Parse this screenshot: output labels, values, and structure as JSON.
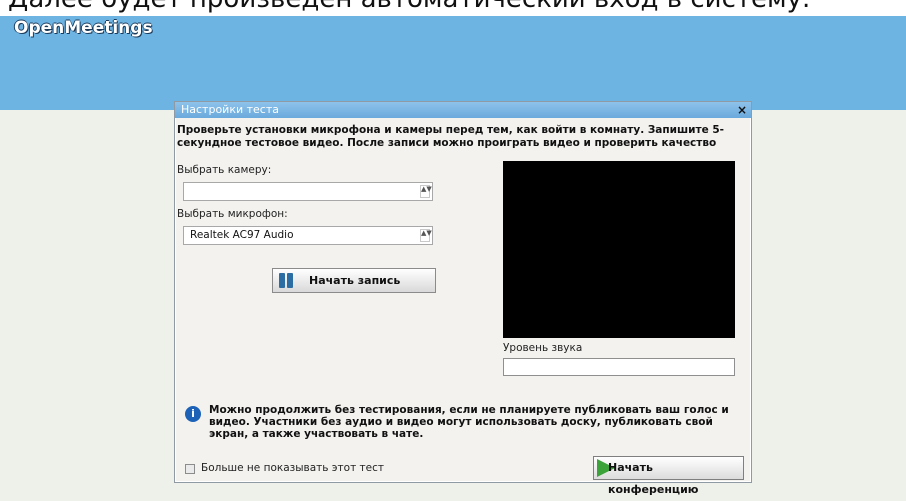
{
  "page": {
    "caption": "Далее будет произведен автоматический вход в систему.",
    "brand": "OpenMeetings"
  },
  "dialog": {
    "title": "Настройки теста",
    "close_glyph": "×",
    "instructions": "Проверьте установки микрофона и камеры перед тем, как войти в комнату. Запишите 5-секундное тестовое видео. После записи можно проиграть видео и проверить качество",
    "camera": {
      "label": "Выбрать камеру:",
      "value": ""
    },
    "microphone": {
      "label": "Выбрать микрофон:",
      "value": "Realtek AC97 Audio"
    },
    "spinner_glyph": "▲▼",
    "record_button": {
      "label": "Начать запись",
      "icon": "record-bars-icon"
    },
    "sound_level_label": "Уровень звука",
    "info": {
      "icon": "info-icon",
      "glyph": "i",
      "text": "Можно продолжить без тестирования, если не планируете публиковать ваш голос и видео. Участники без аудио и видео могут использовать доску, публиковать свой экран, а также участвовать в чате."
    },
    "dont_show_label": "Больше не показывать этот тест",
    "start_button": {
      "label": "Начать конференцию",
      "icon": "play-arrow-icon"
    }
  },
  "colors": {
    "header": "#6eb4e3",
    "background": "#eef0ea",
    "accent_green": "#3ca33a"
  }
}
